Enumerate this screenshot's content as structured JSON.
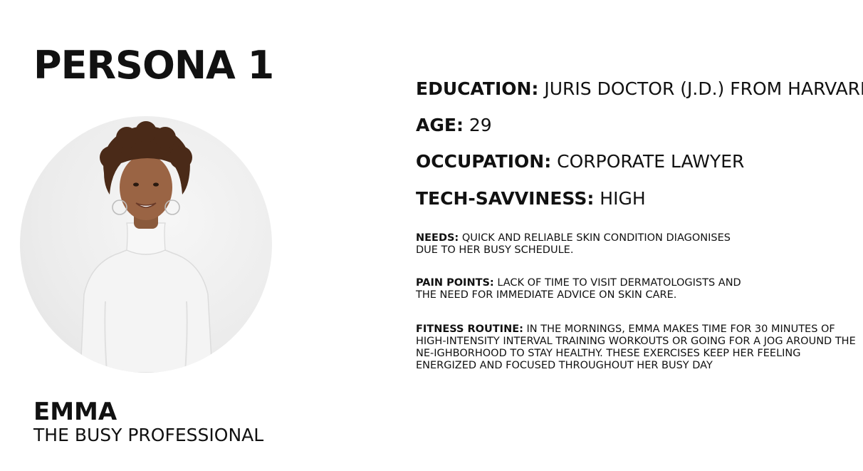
{
  "title": "PERSONA 1",
  "persona": {
    "name": "EMMA",
    "tagline": "THE BUSY PROFESSIONAL",
    "photo_icon": "person-portrait-icon"
  },
  "facts": {
    "education": {
      "label": "EDUCATION:",
      "value": "JURIS DOCTOR (J.D.) FROM  HARVARD"
    },
    "age": {
      "label": "AGE:",
      "value": "29"
    },
    "occupation": {
      "label": "OCCUPATION:",
      "value": "CORPORATE LAWYER"
    },
    "tech_savviness": {
      "label": "TECH-SAVVINESS:",
      "value": "HIGH"
    }
  },
  "details": {
    "needs": {
      "label": "NEEDS:",
      "text": "QUICK AND RELIABLE SKIN CONDITION DIAGONISES DUE TO HER BUSY SCHEDULE."
    },
    "pain_points": {
      "label": "PAIN POINTS:",
      "text": "LACK OF TIME TO VISIT DERMATOLOGISTS AND THE NEED FOR IMMEDIATE ADVICE ON SKIN CARE."
    },
    "fitness_routine": {
      "label": "FITNESS ROUTINE:",
      "text": "IN THE MORNINGS, EMMA MAKES TIME FOR 30 MINUTES OF HIGH-INTENSITY INTERVAL TRAINING WORKOUTS OR GOING FOR A JOG AROUND THE NE-IGHBORHOOD TO STAY HEALTHY. THESE EXERCISES KEEP HER FEELING ENERGIZED AND FOCUSED THROUGHOUT HER BUSY DAY"
    }
  }
}
